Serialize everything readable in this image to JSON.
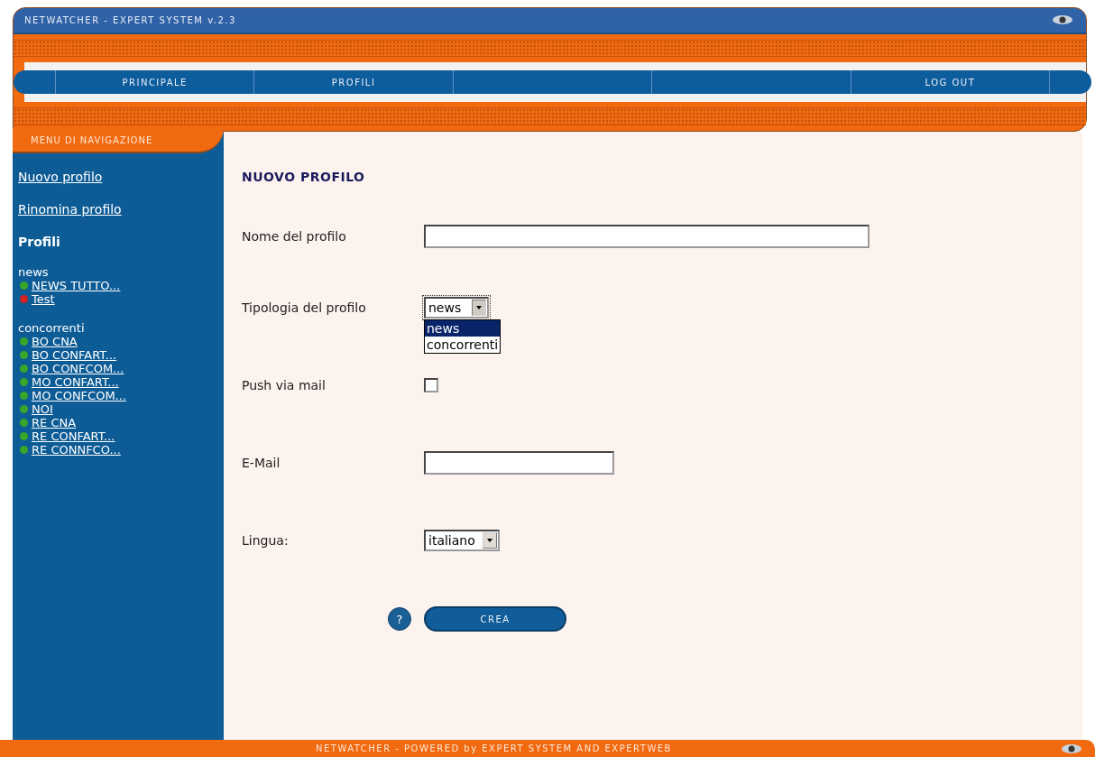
{
  "header": {
    "title": "NETWATCHER - EXPERT SYSTEM v.2.3"
  },
  "nav": [
    {
      "kind": "spacer"
    },
    {
      "kind": "link",
      "label": "PRINCIPALE"
    },
    {
      "kind": "link",
      "label": "PROFILI"
    },
    {
      "kind": "blank"
    },
    {
      "kind": "blank"
    },
    {
      "kind": "link",
      "label": "LOG OUT"
    },
    {
      "kind": "spacer"
    }
  ],
  "sidebar": {
    "tab": "MENU DI NAVIGAZIONE",
    "links": [
      "Nuovo profilo",
      "Rinomina profilo"
    ],
    "heading": "Profili",
    "groups": [
      {
        "name": "news",
        "items": [
          {
            "label": "NEWS TUTTO...",
            "color": "#3aa52a"
          },
          {
            "label": "Test",
            "color": "#d42020"
          }
        ]
      },
      {
        "name": "concorrenti",
        "items": [
          {
            "label": "BO CNA",
            "color": "#3aa52a"
          },
          {
            "label": "BO CONFART...",
            "color": "#3aa52a"
          },
          {
            "label": "BO CONFCOM...",
            "color": "#3aa52a"
          },
          {
            "label": "MO CONFART...",
            "color": "#3aa52a"
          },
          {
            "label": "MO CONFCOM...",
            "color": "#3aa52a"
          },
          {
            "label": "NOI",
            "color": "#3aa52a"
          },
          {
            "label": "RE CNA",
            "color": "#3aa52a"
          },
          {
            "label": "RE CONFART...",
            "color": "#3aa52a"
          },
          {
            "label": "RE CONNFCO...",
            "color": "#3aa52a"
          }
        ]
      }
    ]
  },
  "form": {
    "title": "NUOVO PROFILO",
    "fields": [
      {
        "kind": "text",
        "label": "Nome del profilo"
      },
      {
        "kind": "select",
        "label": "Tipologia del profilo",
        "value": "news",
        "expanded": true,
        "options": [
          {
            "label": "news",
            "selected": true
          },
          {
            "label": "concorrenti",
            "selected": false
          }
        ]
      },
      {
        "kind": "checkbox",
        "label": "Push via mail",
        "checked": false
      },
      {
        "kind": "short-text",
        "label": "E-Mail"
      },
      {
        "kind": "select",
        "label": "Lingua:",
        "value": "italiano"
      }
    ],
    "submit": "CREA",
    "help": "?"
  },
  "footer": "NETWATCHER - POWERED by EXPERT SYSTEM AND EXPERTWEB"
}
